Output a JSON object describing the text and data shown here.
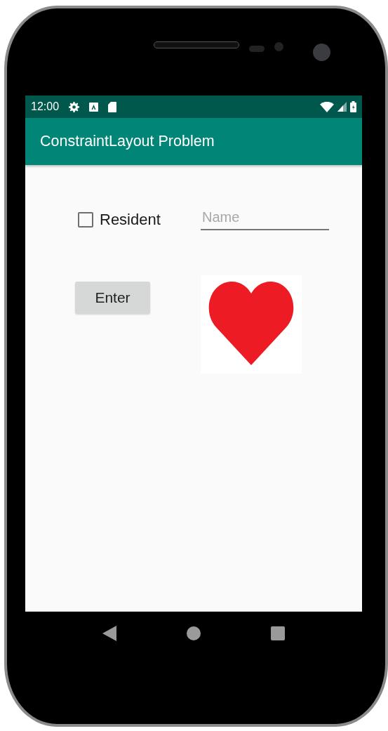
{
  "status_bar": {
    "time": "12:00"
  },
  "app_bar": {
    "title": "ConstraintLayout Problem"
  },
  "resident_checkbox": {
    "label": "Resident",
    "checked": false
  },
  "name_field": {
    "placeholder": "Name"
  },
  "enter_button": {
    "label": "Enter"
  },
  "image": {
    "kind": "heart"
  }
}
